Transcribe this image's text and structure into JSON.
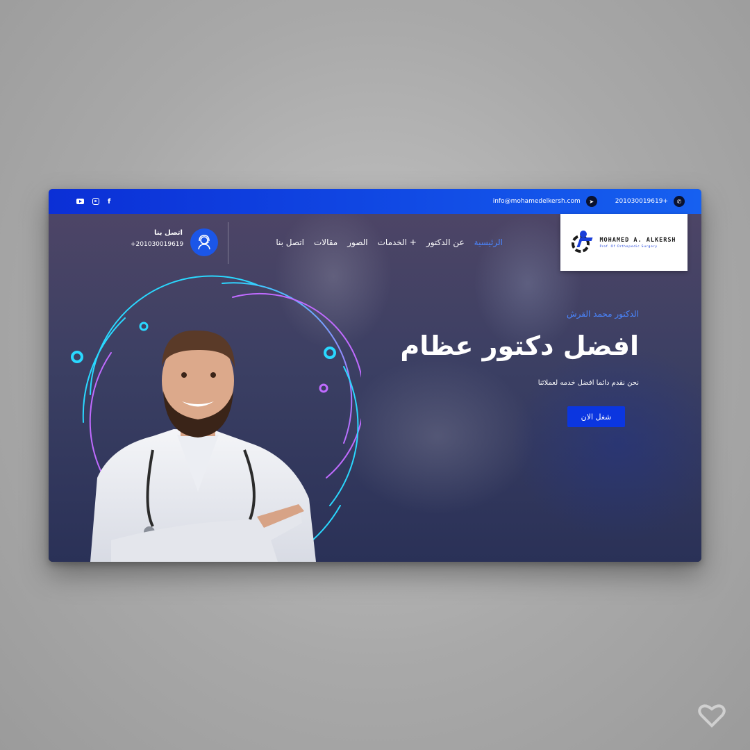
{
  "topbar": {
    "email": "info@mohamedelkersh.com",
    "phone": "201030019619+",
    "social_youtube": "youtube",
    "social_instagram": "instagram",
    "social_facebook": "f"
  },
  "logo": {
    "name": "MOHAMED A. ALKERSH",
    "subtitle": "Prof. Of Orthopedic Surgery"
  },
  "nav": {
    "items": [
      {
        "label": "الرئيسية",
        "active": true
      },
      {
        "label": "عن الدكتور"
      },
      {
        "label": "الخدمات +"
      },
      {
        "label": "الصور"
      },
      {
        "label": "مقالات"
      },
      {
        "label": "اتصل بنا"
      }
    ]
  },
  "contact": {
    "label": "اتصل بنا",
    "phone": "+201030019619"
  },
  "hero": {
    "kicker": "الدكتور محمد القرش",
    "headline": "افضل دكتور عظام",
    "tagline": "نحن نقدم دائما افضل خدمه لعملائنا",
    "cta_label": "شغل الان"
  },
  "colors": {
    "primary": "#0b36e0",
    "accent_link": "#4a86ff",
    "ring_cyan": "#2ad8ff",
    "ring_purple": "#c06bff"
  }
}
